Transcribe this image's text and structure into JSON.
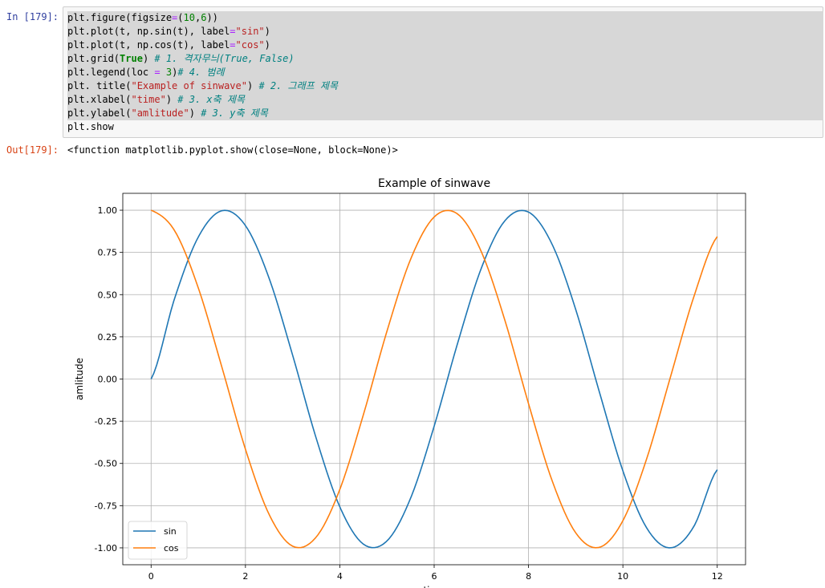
{
  "cell": {
    "in_prompt": "In [179]:",
    "out_prompt": "Out[179]:",
    "output_text": "<function matplotlib.pyplot.show(close=None, block=None)>",
    "code_lines": [
      [
        {
          "t": "plt.figure(figsize"
        },
        {
          "t": "=",
          "c": "op"
        },
        {
          "t": "("
        },
        {
          "t": "10",
          "c": "num"
        },
        {
          "t": ","
        },
        {
          "t": "6",
          "c": "num"
        },
        {
          "t": "))"
        }
      ],
      [
        {
          "t": "plt.plot(t, np.sin(t), label"
        },
        {
          "t": "=",
          "c": "op"
        },
        {
          "t": "\"sin\"",
          "c": "str"
        },
        {
          "t": ")"
        }
      ],
      [
        {
          "t": "plt.plot(t, np.cos(t), label"
        },
        {
          "t": "=",
          "c": "op"
        },
        {
          "t": "\"cos\"",
          "c": "str"
        },
        {
          "t": ")"
        }
      ],
      [
        {
          "t": "plt.grid("
        },
        {
          "t": "True",
          "c": "kw"
        },
        {
          "t": ") "
        },
        {
          "t": "# 1. 격자무늬(True, False)",
          "c": "cm"
        }
      ],
      [
        {
          "t": "plt.legend(loc "
        },
        {
          "t": "=",
          "c": "op"
        },
        {
          "t": " "
        },
        {
          "t": "3",
          "c": "num"
        },
        {
          "t": ")"
        },
        {
          "t": "# 4. 범례",
          "c": "cm"
        }
      ],
      [
        {
          "t": "plt. title("
        },
        {
          "t": "\"Example of sinwave\"",
          "c": "str"
        },
        {
          "t": ") "
        },
        {
          "t": "# 2. 그래프 제목",
          "c": "cm"
        }
      ],
      [
        {
          "t": "plt.xlabel("
        },
        {
          "t": "\"time\"",
          "c": "str"
        },
        {
          "t": ") "
        },
        {
          "t": "# 3. x축 제목",
          "c": "cm"
        }
      ],
      [
        {
          "t": "plt.ylabel("
        },
        {
          "t": "\"amlitude\"",
          "c": "str"
        },
        {
          "t": ") "
        },
        {
          "t": "# 3. y축 제목",
          "c": "cm"
        }
      ],
      [
        {
          "t": "plt.show"
        }
      ]
    ]
  },
  "chart_data": {
    "type": "line",
    "title": "Example of sinwave",
    "xlabel": "time",
    "ylabel": "amlitude",
    "xlim": [
      -0.6,
      12.6
    ],
    "ylim": [
      -1.1,
      1.1
    ],
    "xticks": [
      0,
      2,
      4,
      6,
      8,
      10,
      12
    ],
    "yticks": [
      1.0,
      0.75,
      0.5,
      0.25,
      0.0,
      -0.25,
      -0.5,
      -0.75,
      -1.0
    ],
    "ytick_labels": [
      "1.00",
      "0.75",
      "0.50",
      "0.25",
      "0.00",
      "-0.25",
      "-0.50",
      "-0.75",
      "-1.00"
    ],
    "grid": true,
    "legend_position": "lower-left",
    "x": [
      0,
      0.5,
      1,
      1.5,
      2,
      2.5,
      3,
      3.5,
      4,
      4.5,
      5,
      5.5,
      6,
      6.5,
      7,
      7.5,
      8,
      8.5,
      9,
      9.5,
      10,
      10.5,
      11,
      11.5,
      12
    ],
    "series": [
      {
        "name": "sin",
        "color": "#1f77b4",
        "values": [
          0.0,
          0.479,
          0.841,
          0.997,
          0.909,
          0.598,
          0.141,
          -0.351,
          -0.757,
          -0.978,
          -0.959,
          -0.706,
          -0.279,
          0.215,
          0.657,
          0.938,
          0.989,
          0.798,
          0.412,
          -0.075,
          -0.544,
          -0.88,
          -1.0,
          -0.875,
          -0.537
        ]
      },
      {
        "name": "cos",
        "color": "#ff7f0e",
        "values": [
          1.0,
          0.878,
          0.54,
          0.071,
          -0.416,
          -0.801,
          -0.99,
          -0.936,
          -0.654,
          -0.211,
          0.284,
          0.709,
          0.96,
          0.977,
          0.754,
          0.347,
          -0.146,
          -0.602,
          -0.911,
          -0.997,
          -0.839,
          -0.476,
          0.004,
          0.484,
          0.844
        ]
      }
    ]
  }
}
